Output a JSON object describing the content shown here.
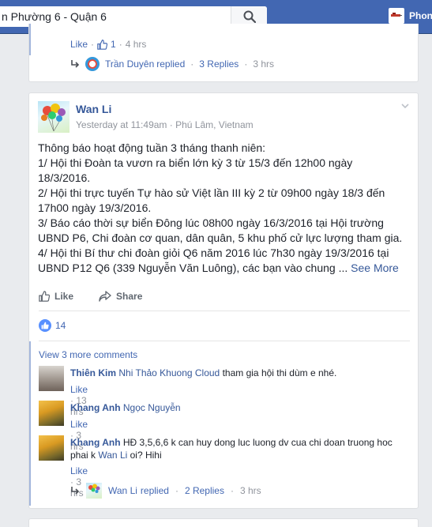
{
  "search": {
    "value": "n Phường 6 - Quận 6"
  },
  "profile": {
    "label": "Phon"
  },
  "prev_post": {
    "like_label": "Like",
    "like_count": "1",
    "time": "4 hrs",
    "replier": "Trần Duyên",
    "replied_word": "replied",
    "replies": "3 Replies",
    "reply_time": "3 hrs"
  },
  "post": {
    "author": "Wan Li",
    "time": "Yesterday at 11:49am",
    "location": "Phú Lâm, Vietnam",
    "lines": [
      "Thông báo hoạt động tuần 3 tháng thanh niên:",
      "1/ Hội thi Đoàn ta vươn ra biển lớn kỳ 3 từ 15/3 đến 12h00 ngày",
      "18/3/2016.",
      "2/ Hội thi trực tuyến Tự hào sử Việt lần III kỳ 2 từ 09h00 ngày 18/3 đến",
      "17h00 ngày 19/3/2016.",
      "3/ Báo cáo thời sự biển Đông lúc 08h00 ngày 16/3/2016 tại Hội trường",
      "UBND P6, Chi đoàn cơ quan, dân quân, 5 khu phố cử lực lượng tham gia.",
      "4/ Hội thi Bí thư chi đoàn giỏi Q6 năm 2016 lúc 7h30 ngày 19/3/2016 tại",
      "UBND P12 Q6 (339 Nguyễn Văn Luông), các bạn vào chung ..."
    ],
    "see_more": "See More",
    "like_action": "Like",
    "share_action": "Share",
    "reaction_count": "14",
    "view_more_comments": "View 3 more comments"
  },
  "comments": [
    {
      "name": "Thiên Kim",
      "tag": "Nhi Thảo Khuong Cloud",
      "text": "tham gia hội thi dùm e nhé.",
      "like": "Like",
      "time": "13 hrs"
    },
    {
      "name": "Khang Anh",
      "tag": "Ngọc Nguyễn",
      "text": "",
      "like": "Like",
      "time": "3 hrs"
    },
    {
      "name": "Khang Anh",
      "text_a": "HĐ 3,5,6,6 k can huy dong luc luong dv cua chi doan truong hoc",
      "text_b": "phai k",
      "tag": "Wan Li",
      "text_c": "oi? Hihi",
      "like": "Like",
      "time": "3 hrs"
    }
  ],
  "post_reply": {
    "replier": "Wan Li",
    "replied_word": "replied",
    "replies": "2 Replies",
    "reply_time": "3 hrs"
  }
}
